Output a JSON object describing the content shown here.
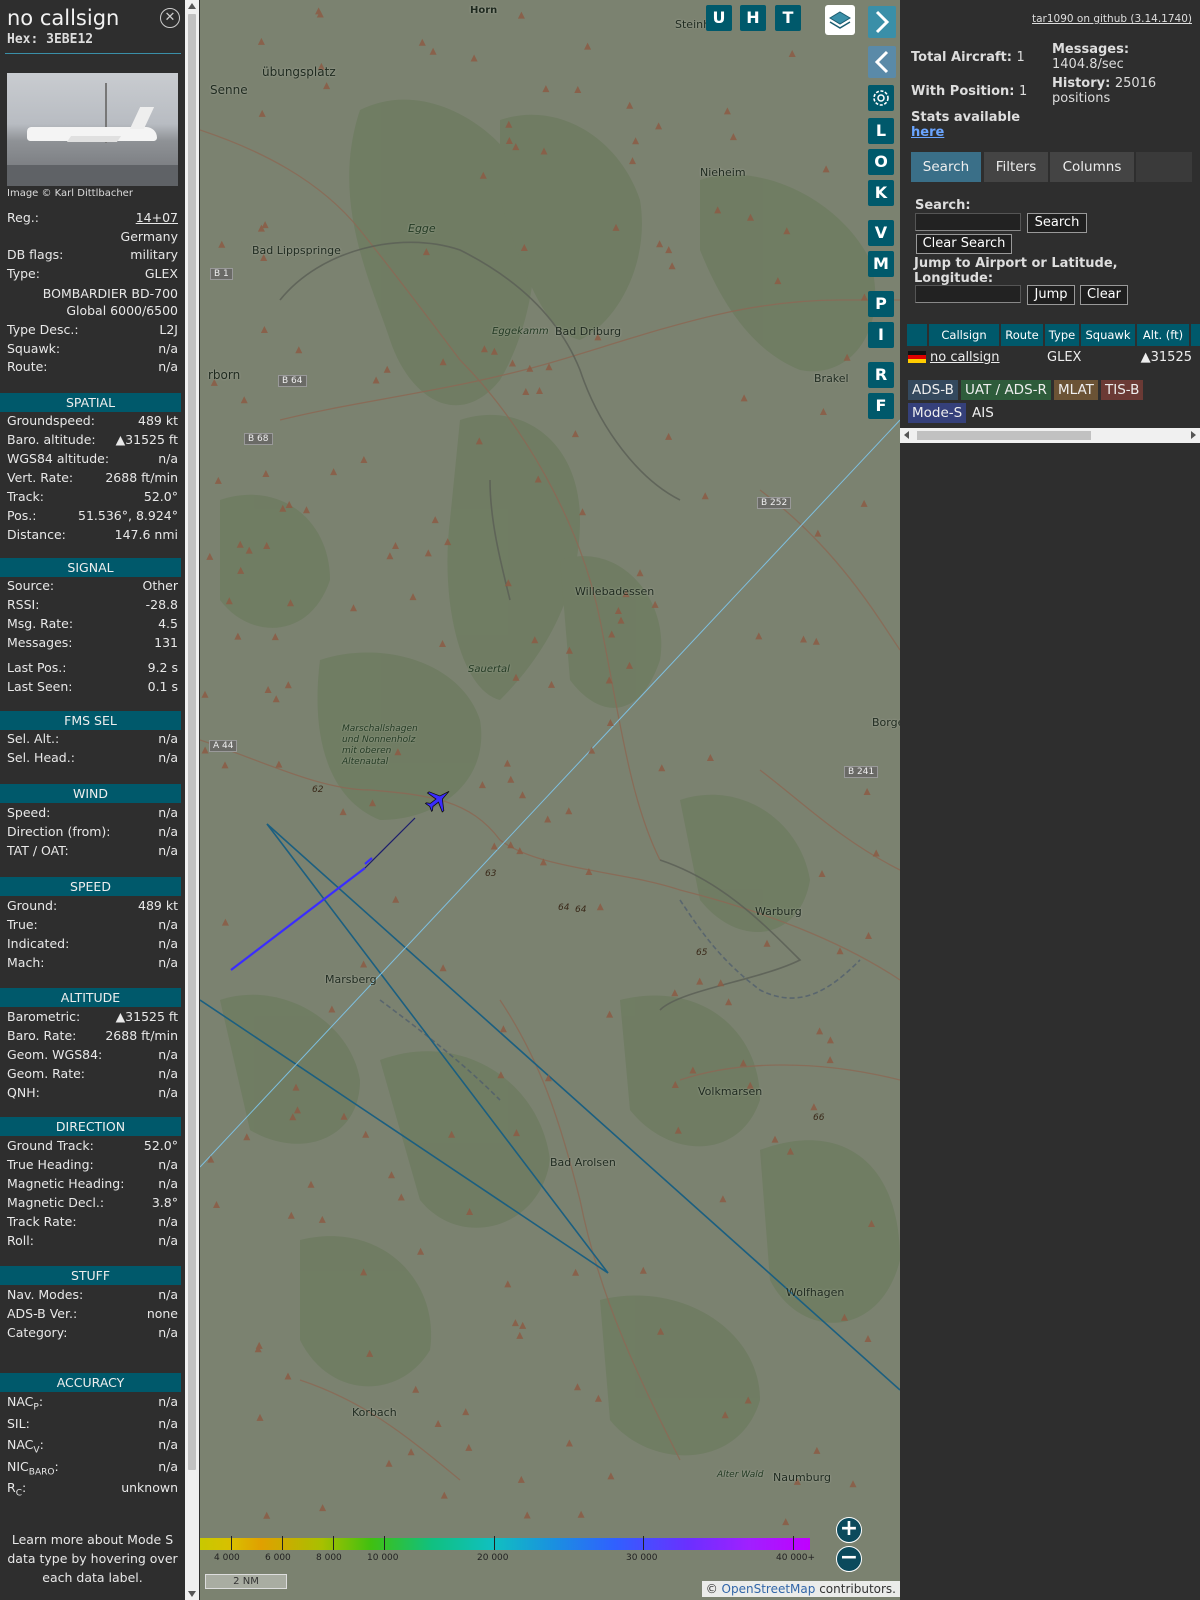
{
  "info": {
    "callsign": "no callsign",
    "hex": "Hex:  3EBE12",
    "photo_credit": "Image © Karl Dittlbacher",
    "details": [
      {
        "label": "Reg.:",
        "value": "14+07",
        "link": true
      },
      {
        "label": "",
        "value": "Germany"
      },
      {
        "label": "DB flags:",
        "value": "military"
      },
      {
        "label": "Type:",
        "value": "GLEX"
      }
    ],
    "type_full_1": "BOMBARDIER BD-700",
    "type_full_2": "Global 6000/6500",
    "details2": [
      {
        "label": "Type Desc.:",
        "value": "L2J"
      },
      {
        "label": "Squawk:",
        "value": "n/a"
      },
      {
        "label": "Route:",
        "value": "n/a"
      }
    ],
    "sections": {
      "spatial": {
        "title": "SPATIAL",
        "rows": [
          {
            "label": "Groundspeed:",
            "value": "489 kt"
          },
          {
            "label": "Baro. altitude:",
            "value": "▲31525 ft"
          },
          {
            "label": "WGS84 altitude:",
            "value": "n/a"
          },
          {
            "label": "Vert. Rate:",
            "value": "2688 ft/min"
          },
          {
            "label": "Track:",
            "value": "52.0°"
          },
          {
            "label": "Pos.:",
            "value": "51.536°, 8.924°"
          },
          {
            "label": "Distance:",
            "value": "147.6 nmi"
          }
        ]
      },
      "signal": {
        "title": "SIGNAL",
        "rows": [
          {
            "label": "Source:",
            "value": "Other"
          },
          {
            "label": "RSSI:",
            "value": "-28.8"
          },
          {
            "label": "Msg. Rate:",
            "value": "4.5"
          },
          {
            "label": "Messages:",
            "value": "131"
          },
          {
            "label": "Last Pos.:",
            "value": "9.2 s"
          },
          {
            "label": "Last Seen:",
            "value": "0.1 s"
          }
        ]
      },
      "fms": {
        "title": "FMS SEL",
        "rows": [
          {
            "label": "Sel. Alt.:",
            "value": "n/a"
          },
          {
            "label": "Sel. Head.:",
            "value": "n/a"
          }
        ]
      },
      "wind": {
        "title": "WIND",
        "rows": [
          {
            "label": "Speed:",
            "value": "n/a"
          },
          {
            "label": "Direction (from):",
            "value": "n/a"
          },
          {
            "label": "TAT / OAT:",
            "value": "n/a"
          }
        ]
      },
      "speed": {
        "title": "SPEED",
        "rows": [
          {
            "label": "Ground:",
            "value": "489 kt"
          },
          {
            "label": "True:",
            "value": "n/a"
          },
          {
            "label": "Indicated:",
            "value": "n/a"
          },
          {
            "label": "Mach:",
            "value": "n/a"
          }
        ]
      },
      "altitude": {
        "title": "ALTITUDE",
        "rows": [
          {
            "label": "Barometric:",
            "value": "▲31525 ft"
          },
          {
            "label": "Baro. Rate:",
            "value": "2688 ft/min"
          },
          {
            "label": "Geom. WGS84:",
            "value": "n/a"
          },
          {
            "label": "Geom. Rate:",
            "value": "n/a"
          },
          {
            "label": "QNH:",
            "value": "n/a"
          }
        ]
      },
      "direction": {
        "title": "DIRECTION",
        "rows": [
          {
            "label": "Ground Track:",
            "value": "52.0°"
          },
          {
            "label": "True Heading:",
            "value": "n/a"
          },
          {
            "label": "Magnetic Heading:",
            "value": "n/a"
          },
          {
            "label": "Magnetic Decl.:",
            "value": "3.8°"
          },
          {
            "label": "Track Rate:",
            "value": "n/a"
          },
          {
            "label": "Roll:",
            "value": "n/a"
          }
        ]
      },
      "stuff": {
        "title": "STUFF",
        "rows": [
          {
            "label": "Nav. Modes:",
            "value": "n/a"
          },
          {
            "label": "ADS-B Ver.:",
            "value": "none"
          },
          {
            "label": "Category:",
            "value": "n/a"
          }
        ]
      },
      "accuracy": {
        "title": "ACCURACY",
        "rows": [
          {
            "label": "NAC",
            "sub": "P",
            "value": "n/a"
          },
          {
            "label": "SIL:",
            "sub": "",
            "value": "n/a"
          },
          {
            "label": "NAC",
            "sub": "V",
            "value": "n/a"
          },
          {
            "label": "NIC",
            "sub": "BARO",
            "value": "n/a"
          },
          {
            "label": "R",
            "sub": "C",
            "value": "unknown"
          }
        ]
      }
    },
    "footnote": "Learn more about Mode S data type by hovering over each data label."
  },
  "map": {
    "buttons_top": [
      "U",
      "H",
      "T"
    ],
    "side_buttons": [
      "L",
      "O",
      "K",
      "V",
      "M",
      "P",
      "I",
      "R",
      "F"
    ],
    "place_labels": [
      {
        "text": "Horn"
      },
      {
        "text": "Steinh"
      },
      {
        "text": "übungsplatz"
      },
      {
        "text": "Senne"
      },
      {
        "text": "Nieheim"
      },
      {
        "text": "Bad Lippspringe"
      },
      {
        "text": "Egge"
      },
      {
        "text": "Bad Driburg"
      },
      {
        "text": "Eggekamm"
      },
      {
        "text": "Brakel"
      },
      {
        "text": "rborn"
      },
      {
        "text": "Willebadessen"
      },
      {
        "text": "Sauertal"
      },
      {
        "text": "Borge"
      },
      {
        "text": "Marschallshagen"
      },
      {
        "text": "und Nonnenholz"
      },
      {
        "text": "mit oberen"
      },
      {
        "text": "Altenautal"
      },
      {
        "text": "Warburg"
      },
      {
        "text": "Marsberg"
      },
      {
        "text": "Volkmarsen"
      },
      {
        "text": "Bad Arolsen"
      },
      {
        "text": "Wolfhagen"
      },
      {
        "text": "Korbach"
      },
      {
        "text": "Alter Wald"
      },
      {
        "text": "Naumburg"
      }
    ],
    "road_labels": [
      "B 1",
      "B 64",
      "B 68",
      "B 252",
      "A 44",
      "B 241",
      "62",
      "63",
      "64",
      "64",
      "65",
      "66"
    ],
    "alt_scale_labels": [
      "4 000",
      "6 000",
      "8 000",
      "10 000",
      "20 000",
      "30 000",
      "40 000+"
    ],
    "scale": "2 NM",
    "attribution_sym": "©",
    "attribution_link": "OpenStreetMap",
    "attribution_rest": "contributors.",
    "zoom_in": "+",
    "zoom_out": "−"
  },
  "right": {
    "github": "tar1090 on github (3.14.1740)",
    "total_aircraft_label": "Total Aircraft:",
    "total_aircraft": "1",
    "with_position_label": "With Position:",
    "with_position": "1",
    "messages_label": "Messages:",
    "messages": "1404.8/sec",
    "history_label": "History:",
    "history_count": "25016",
    "history_unit": "positions",
    "stats_label": "Stats available",
    "stats_link": "here",
    "tabs": [
      "Search",
      "Filters",
      "Columns"
    ],
    "search_label": "Search:",
    "search_button": "Search",
    "clear_search_button": "Clear Search",
    "jump_label_1": "Jump to Airport or Latitude,",
    "jump_label_2": "Longitude:",
    "jump_button": "Jump",
    "clear_button": "Clear",
    "table_headers": [
      "Callsign",
      "Route",
      "Type",
      "Squawk",
      "Alt. (ft)"
    ],
    "table_rows": [
      {
        "callsign": "no callsign",
        "route": "",
        "type": "GLEX",
        "squawk": "",
        "alt": "▲31525"
      }
    ],
    "sources": [
      {
        "label": "ADS-B",
        "color": "#34495e"
      },
      {
        "label": "UAT / ADS-R",
        "color": "#2e5c3b"
      },
      {
        "label": "MLAT",
        "color": "#6b5335"
      },
      {
        "label": "TIS-B",
        "color": "#6b3a35"
      },
      {
        "label": "Mode-S",
        "color": "#35407a"
      },
      {
        "label": "AIS",
        "color": "#2e2e2e"
      }
    ]
  },
  "colors": {
    "accent": "#00596b",
    "tab_active": "#3a6f88",
    "trail": "#3a2cff",
    "tracks": "#1b5f80",
    "map_bg": "#7d8470"
  }
}
